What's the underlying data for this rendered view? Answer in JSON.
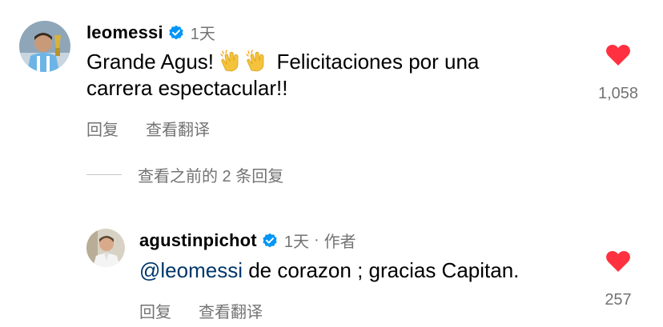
{
  "comments": [
    {
      "username": "leomessi",
      "time": "1天",
      "text_parts": [
        "Grande Agus!",
        "Felicitaciones por una",
        "carrera espectacular!!"
      ],
      "emoji": "clapping-hands-emoji",
      "actions": {
        "reply": "回复",
        "translate": "查看翻译"
      },
      "likes": "1,058"
    },
    {
      "username": "agustinpichot",
      "time": "1天",
      "dot": "·",
      "author_badge": "作者",
      "mention": "@leomessi",
      "text": " de corazon ; gracias Capitan.",
      "actions": {
        "reply": "回复",
        "translate": "查看翻译"
      },
      "likes": "257"
    }
  ],
  "view_previous_replies": "查看之前的 2 条回复",
  "colors": {
    "verified": "#0095f6",
    "heart": "#ff3040",
    "secondary_text": "#737373",
    "mention": "#00376b"
  }
}
